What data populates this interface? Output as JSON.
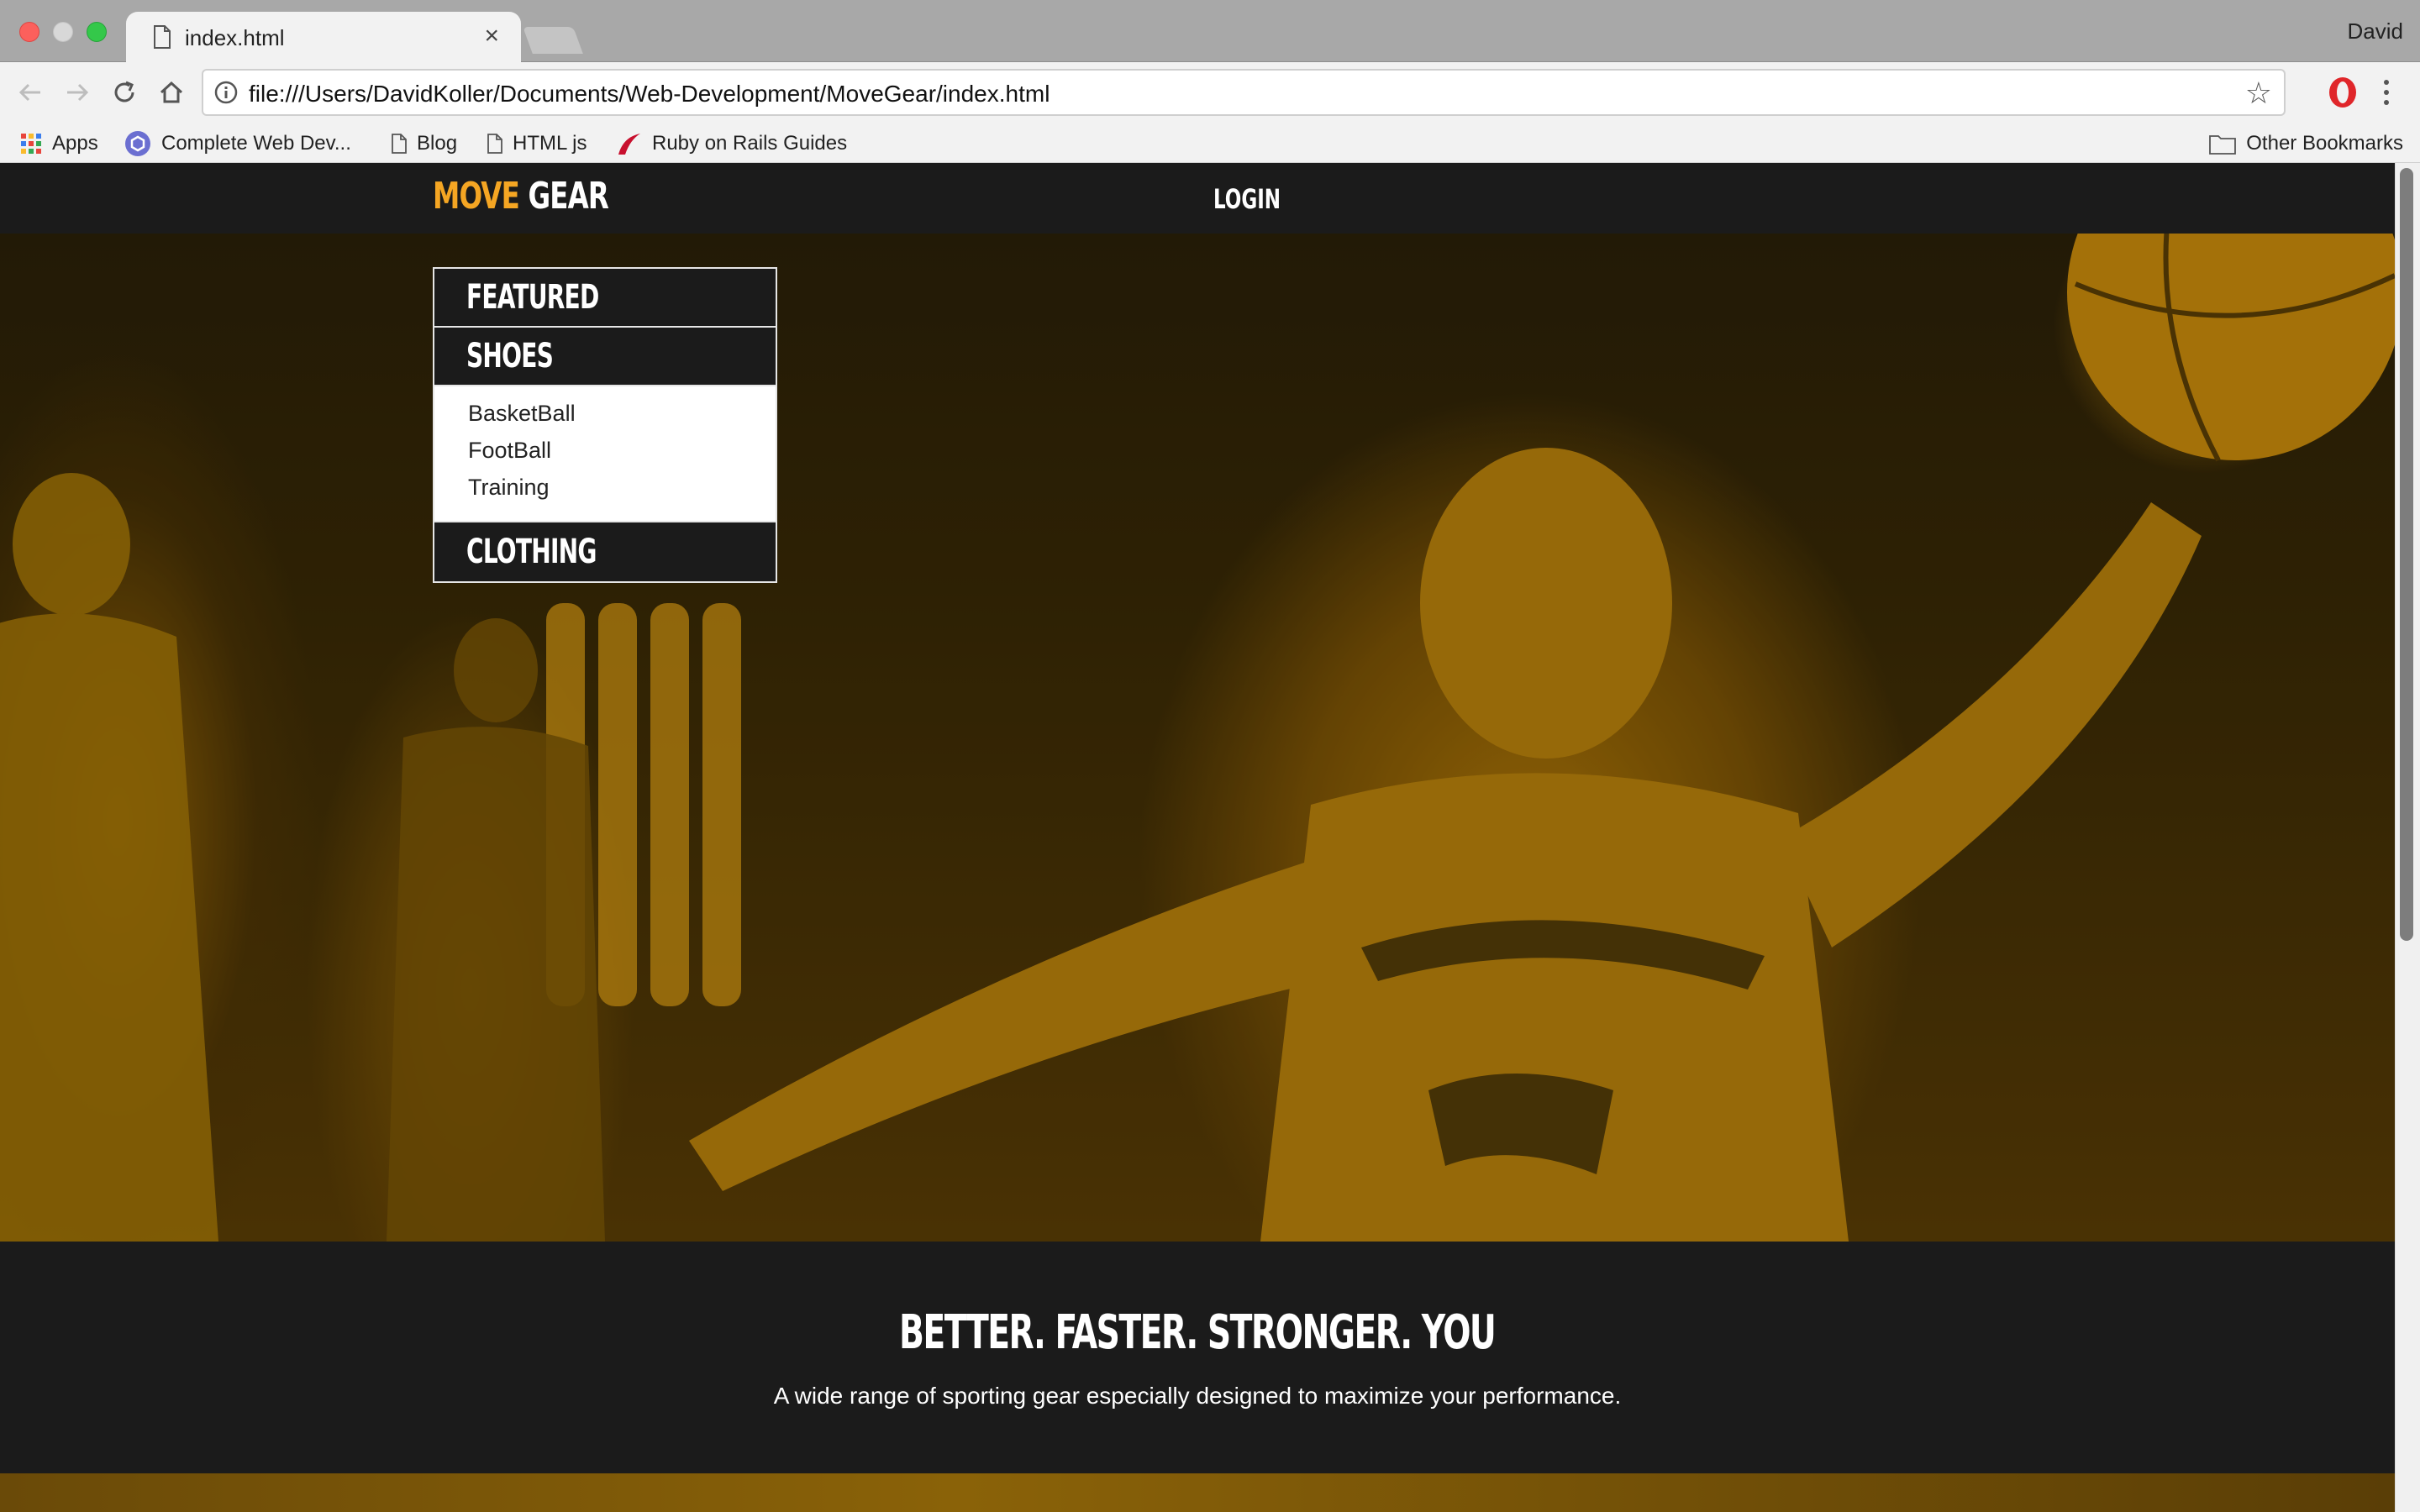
{
  "browser": {
    "tab_title": "index.html",
    "tab_close": "×",
    "profile_name": "David",
    "url": "file:///Users/DavidKoller/Documents/Web-Development/MoveGear/index.html",
    "star": "☆",
    "bookmarks": [
      {
        "label": "Apps"
      },
      {
        "label": "Complete Web Dev..."
      },
      {
        "label": "Blog"
      },
      {
        "label": "HTML js"
      },
      {
        "label": "Ruby on Rails Guides"
      }
    ],
    "other_bookmarks": "Other Bookmarks"
  },
  "site": {
    "logo_primary": "MOVE",
    "logo_secondary": "GEAR",
    "login": "LOGIN",
    "brand_color": "#f5a623",
    "menu": {
      "featured": "FEATURED",
      "shoes": "SHOES",
      "shoes_items": [
        "BasketBall",
        "FootBall",
        "Training"
      ],
      "clothing": "CLOTHING"
    },
    "tagline": "BETTER. FASTER. STRONGER. YOU",
    "subline": "A wide range of sporting gear especially designed to maximize your performance."
  }
}
